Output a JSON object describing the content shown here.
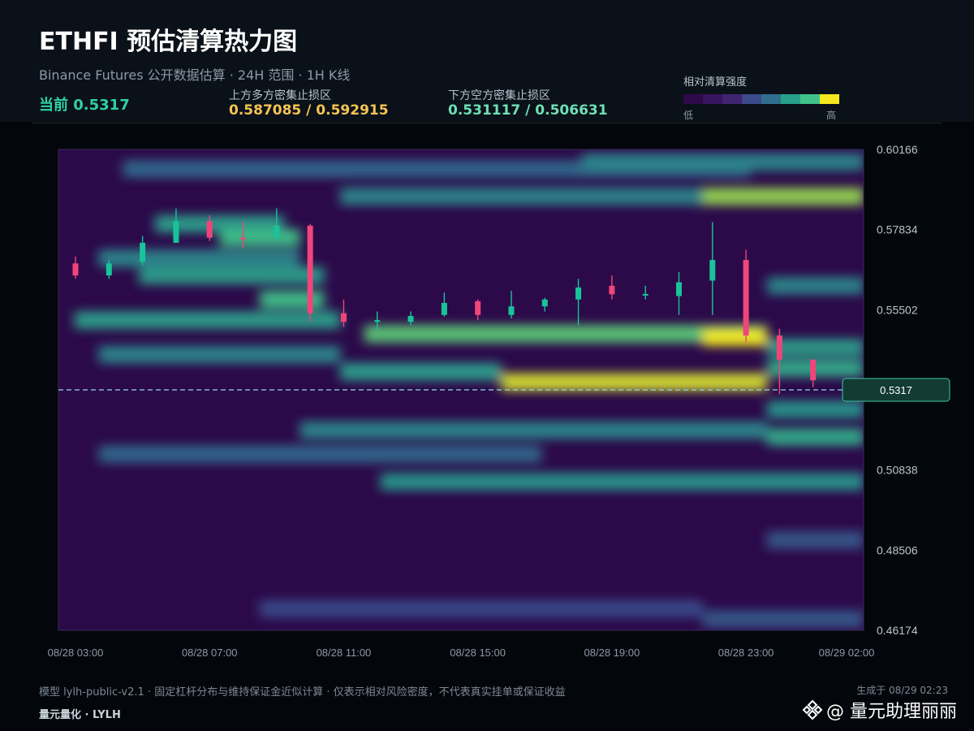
{
  "header": {
    "title": "ETHFI 预估清算热力图",
    "subtitle": "Binance Futures 公开数据估算 · 24H 范围 · 1H K线",
    "current_label": "当前 0.5317",
    "upper_zone_label": "上方多方密集止损区",
    "upper_zone_value": "0.587085 / 0.592915",
    "lower_zone_label": "下方空方密集止损区",
    "lower_zone_value": "0.531117 / 0.506631"
  },
  "legend": {
    "title": "相对清算强度",
    "low": "低",
    "high": "高",
    "colors": [
      "#2f0a4a",
      "#38145e",
      "#3f2470",
      "#3a4a8a",
      "#2f6e8e",
      "#26a08a",
      "#3fc38a",
      "#f6e81e"
    ]
  },
  "colors": {
    "up": "#19c39a",
    "down": "#f0457a",
    "accent": "#2fd1a4",
    "upper_zone": "#f5c451",
    "lower_zone": "#6fe0b4"
  },
  "footer": {
    "note": "模型 lylh-public-v2.1 · 固定杠杆分布与维持保证金近似计算 · 仅表示相对风险密度，不代表真实挂单或保证收益",
    "brand": "量元量化 · LYLH",
    "generated": "生成于 08/29 02:23",
    "watermark": "@ 量元助理丽丽"
  },
  "chart_data": {
    "type": "heatmap",
    "title": "ETHFI 预估清算热力图",
    "y_ticks": [
      "0.60166",
      "0.57834",
      "0.55502",
      "0.53170",
      "0.50838",
      "0.48506",
      "0.46174"
    ],
    "y_ticks_shown": [
      "0.60166",
      "0.57834",
      "0.55502",
      "0.50838",
      "0.48506",
      "0.46174"
    ],
    "ylim": [
      0.46174,
      0.60166
    ],
    "x_ticks": [
      "08/28 03:00",
      "08/28 07:00",
      "08/28 11:00",
      "08/28 15:00",
      "08/28 19:00",
      "08/28 23:00",
      "08/29 02:00"
    ],
    "current_price": 0.5317,
    "current_label": "0.5317",
    "candles": [
      {
        "o": 0.5685,
        "h": 0.5705,
        "l": 0.564,
        "c": 0.565
      },
      {
        "o": 0.565,
        "h": 0.5695,
        "l": 0.564,
        "c": 0.5685
      },
      {
        "o": 0.569,
        "h": 0.5765,
        "l": 0.568,
        "c": 0.5745
      },
      {
        "o": 0.5745,
        "h": 0.5845,
        "l": 0.5745,
        "c": 0.5808
      },
      {
        "o": 0.5808,
        "h": 0.5825,
        "l": 0.575,
        "c": 0.576
      },
      {
        "o": 0.576,
        "h": 0.5808,
        "l": 0.573,
        "c": 0.5755
      },
      {
        "o": 0.576,
        "h": 0.5845,
        "l": 0.575,
        "c": 0.5795
      },
      {
        "o": 0.5795,
        "h": 0.58,
        "l": 0.5515,
        "c": 0.554
      },
      {
        "o": 0.554,
        "h": 0.558,
        "l": 0.55,
        "c": 0.5515
      },
      {
        "o": 0.5515,
        "h": 0.5545,
        "l": 0.549,
        "c": 0.552
      },
      {
        "o": 0.5515,
        "h": 0.5545,
        "l": 0.5505,
        "c": 0.5532
      },
      {
        "o": 0.5535,
        "h": 0.56,
        "l": 0.553,
        "c": 0.557
      },
      {
        "o": 0.5575,
        "h": 0.558,
        "l": 0.552,
        "c": 0.5535
      },
      {
        "o": 0.5535,
        "h": 0.5605,
        "l": 0.5525,
        "c": 0.556
      },
      {
        "o": 0.556,
        "h": 0.5585,
        "l": 0.5545,
        "c": 0.558
      },
      {
        "o": 0.558,
        "h": 0.564,
        "l": 0.5505,
        "c": 0.5615
      },
      {
        "o": 0.562,
        "h": 0.565,
        "l": 0.558,
        "c": 0.5595
      },
      {
        "o": 0.5592,
        "h": 0.562,
        "l": 0.558,
        "c": 0.5596
      },
      {
        "o": 0.559,
        "h": 0.566,
        "l": 0.5535,
        "c": 0.563
      },
      {
        "o": 0.5635,
        "h": 0.5805,
        "l": 0.5535,
        "c": 0.5695
      },
      {
        "o": 0.5695,
        "h": 0.5725,
        "l": 0.5455,
        "c": 0.5475
      },
      {
        "o": 0.5475,
        "h": 0.5495,
        "l": 0.5305,
        "c": 0.5405
      },
      {
        "o": 0.5405,
        "h": 0.5405,
        "l": 0.5325,
        "c": 0.5345
      },
      {
        "o": 0.5345,
        "h": 0.5345,
        "l": 0.5305,
        "c": 0.533
      }
    ],
    "heat_bands": [
      {
        "price": 0.596,
        "intensity": 0.35,
        "from": 0.08,
        "to": 0.86
      },
      {
        "price": 0.598,
        "intensity": 0.45,
        "from": 0.65,
        "to": 1.0
      },
      {
        "price": 0.588,
        "intensity": 0.85,
        "from": 0.8,
        "to": 1.0
      },
      {
        "price": 0.588,
        "intensity": 0.45,
        "from": 0.35,
        "to": 0.8
      },
      {
        "price": 0.58,
        "intensity": 0.55,
        "from": 0.12,
        "to": 0.28
      },
      {
        "price": 0.576,
        "intensity": 0.7,
        "from": 0.2,
        "to": 0.3
      },
      {
        "price": 0.57,
        "intensity": 0.45,
        "from": 0.05,
        "to": 0.3
      },
      {
        "price": 0.565,
        "intensity": 0.55,
        "from": 0.1,
        "to": 0.33
      },
      {
        "price": 0.562,
        "intensity": 0.45,
        "from": 0.88,
        "to": 1.0
      },
      {
        "price": 0.558,
        "intensity": 0.7,
        "from": 0.25,
        "to": 0.33
      },
      {
        "price": 0.552,
        "intensity": 0.55,
        "from": 0.02,
        "to": 0.35
      },
      {
        "price": 0.548,
        "intensity": 0.75,
        "from": 0.38,
        "to": 0.88
      },
      {
        "price": 0.547,
        "intensity": 1.0,
        "from": 0.8,
        "to": 0.88
      },
      {
        "price": 0.544,
        "intensity": 0.55,
        "from": 0.88,
        "to": 1.0
      },
      {
        "price": 0.542,
        "intensity": 0.45,
        "from": 0.05,
        "to": 0.35
      },
      {
        "price": 0.537,
        "intensity": 0.55,
        "from": 0.35,
        "to": 0.55
      },
      {
        "price": 0.534,
        "intensity": 0.95,
        "from": 0.55,
        "to": 0.88
      },
      {
        "price": 0.538,
        "intensity": 0.6,
        "from": 0.88,
        "to": 1.0
      },
      {
        "price": 0.526,
        "intensity": 0.5,
        "from": 0.88,
        "to": 1.0
      },
      {
        "price": 0.52,
        "intensity": 0.45,
        "from": 0.3,
        "to": 0.88
      },
      {
        "price": 0.518,
        "intensity": 0.6,
        "from": 0.88,
        "to": 1.0
      },
      {
        "price": 0.513,
        "intensity": 0.35,
        "from": 0.05,
        "to": 0.6
      },
      {
        "price": 0.505,
        "intensity": 0.5,
        "from": 0.4,
        "to": 1.0
      },
      {
        "price": 0.488,
        "intensity": 0.3,
        "from": 0.88,
        "to": 1.0
      },
      {
        "price": 0.468,
        "intensity": 0.25,
        "from": 0.25,
        "to": 0.8
      },
      {
        "price": 0.465,
        "intensity": 0.3,
        "from": 0.8,
        "to": 1.0
      }
    ]
  }
}
